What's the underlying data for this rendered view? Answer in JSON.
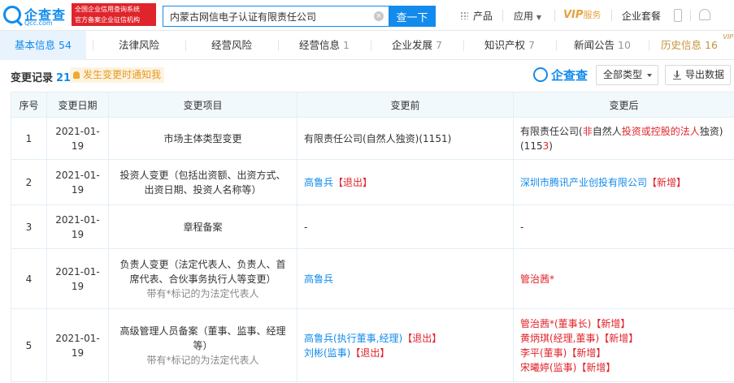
{
  "header": {
    "logo_text": "企查查",
    "logo_sub": "Qcc.com",
    "official_badge_line1": "全国企业信用查询系统",
    "official_badge_line2": "官方备案企业征信机构",
    "search_value": "内蒙古网信电子认证有限责任公司",
    "search_button": "查一下",
    "nav": {
      "products": "产品",
      "apps": "应用",
      "vip": "VIP",
      "vip_service": "服务",
      "enterprise_package": "企业套餐"
    }
  },
  "tabs": [
    {
      "label": "基本信息",
      "count": "54"
    },
    {
      "label": "法律风险",
      "count": ""
    },
    {
      "label": "经营风险",
      "count": ""
    },
    {
      "label": "经营信息",
      "count": "1"
    },
    {
      "label": "企业发展",
      "count": "7"
    },
    {
      "label": "知识产权",
      "count": "7"
    },
    {
      "label": "新闻公告",
      "count": "10"
    },
    {
      "label": "历史信息",
      "count": "16",
      "tag": "VIP"
    }
  ],
  "section": {
    "title": "变更记录",
    "count": "21",
    "notify_label": "发生变更时通知我",
    "watermark": "企查查",
    "type_select": "全部类型",
    "export_label": "导出数据"
  },
  "table": {
    "headers": [
      "序号",
      "变更日期",
      "变更项目",
      "变更前",
      "变更后"
    ],
    "rows": [
      {
        "idx": "1",
        "date": "2021-01-19",
        "item": "市场主体类型变更",
        "item_note": "",
        "before": [
          "有限责任公司(自然人独资)(1151)"
        ],
        "after_parts": [
          {
            "t": "有限责任公司(",
            "c": "plain"
          },
          {
            "t": "非",
            "c": "red"
          },
          {
            "t": "自然人",
            "c": "plain"
          },
          {
            "t": "投资或控股的法人",
            "c": "red"
          },
          {
            "t": "独资)(115",
            "c": "plain"
          },
          {
            "t": "3",
            "c": "red"
          },
          {
            "t": ")",
            "c": "plain"
          }
        ]
      },
      {
        "idx": "2",
        "date": "2021-01-19",
        "item": "投资人变更（包括出资额、出资方式、出资日期、投资人名称等）",
        "item_note": "",
        "before_lines": [
          {
            "link": "高鲁兵",
            "tag": "【退出】"
          }
        ],
        "after_lines": [
          {
            "link": "深圳市腾讯产业创投有限公司",
            "tag": "【新增】"
          }
        ]
      },
      {
        "idx": "3",
        "date": "2021-01-19",
        "item": "章程备案",
        "item_note": "",
        "before": [
          "-"
        ],
        "after": [
          "-"
        ]
      },
      {
        "idx": "4",
        "date": "2021-01-19",
        "item": "负责人变更（法定代表人、负责人、首席代表、合伙事务执行人等变更）",
        "item_note": "带有*标记的为法定代表人",
        "before_lines": [
          {
            "link": "高鲁兵",
            "tag": ""
          }
        ],
        "after_lines": [
          {
            "red": "管治茜*",
            "tag": ""
          }
        ]
      },
      {
        "idx": "5",
        "date": "2021-01-19",
        "item": "高级管理人员备案（董事、监事、经理等）",
        "item_note": "带有*标记的为法定代表人",
        "before_lines": [
          {
            "link": "高鲁兵(执行董事,经理)",
            "tag": "【退出】"
          },
          {
            "link": "刘彬(监事)",
            "tag": "【退出】"
          }
        ],
        "after_lines": [
          {
            "red": "管治茜*(董事长)",
            "tag": "【新增】"
          },
          {
            "red": "黄炳琪(经理,董事)",
            "tag": "【新增】"
          },
          {
            "red": "李平(董事)",
            "tag": "【新增】"
          },
          {
            "red": "宋曦婷(监事)",
            "tag": "【新增】"
          }
        ]
      }
    ]
  },
  "colors": {
    "brand": "#128bed",
    "accent_red": "#e0242b",
    "vip_gold": "#c8943c",
    "notify_orange": "#e69b20"
  }
}
